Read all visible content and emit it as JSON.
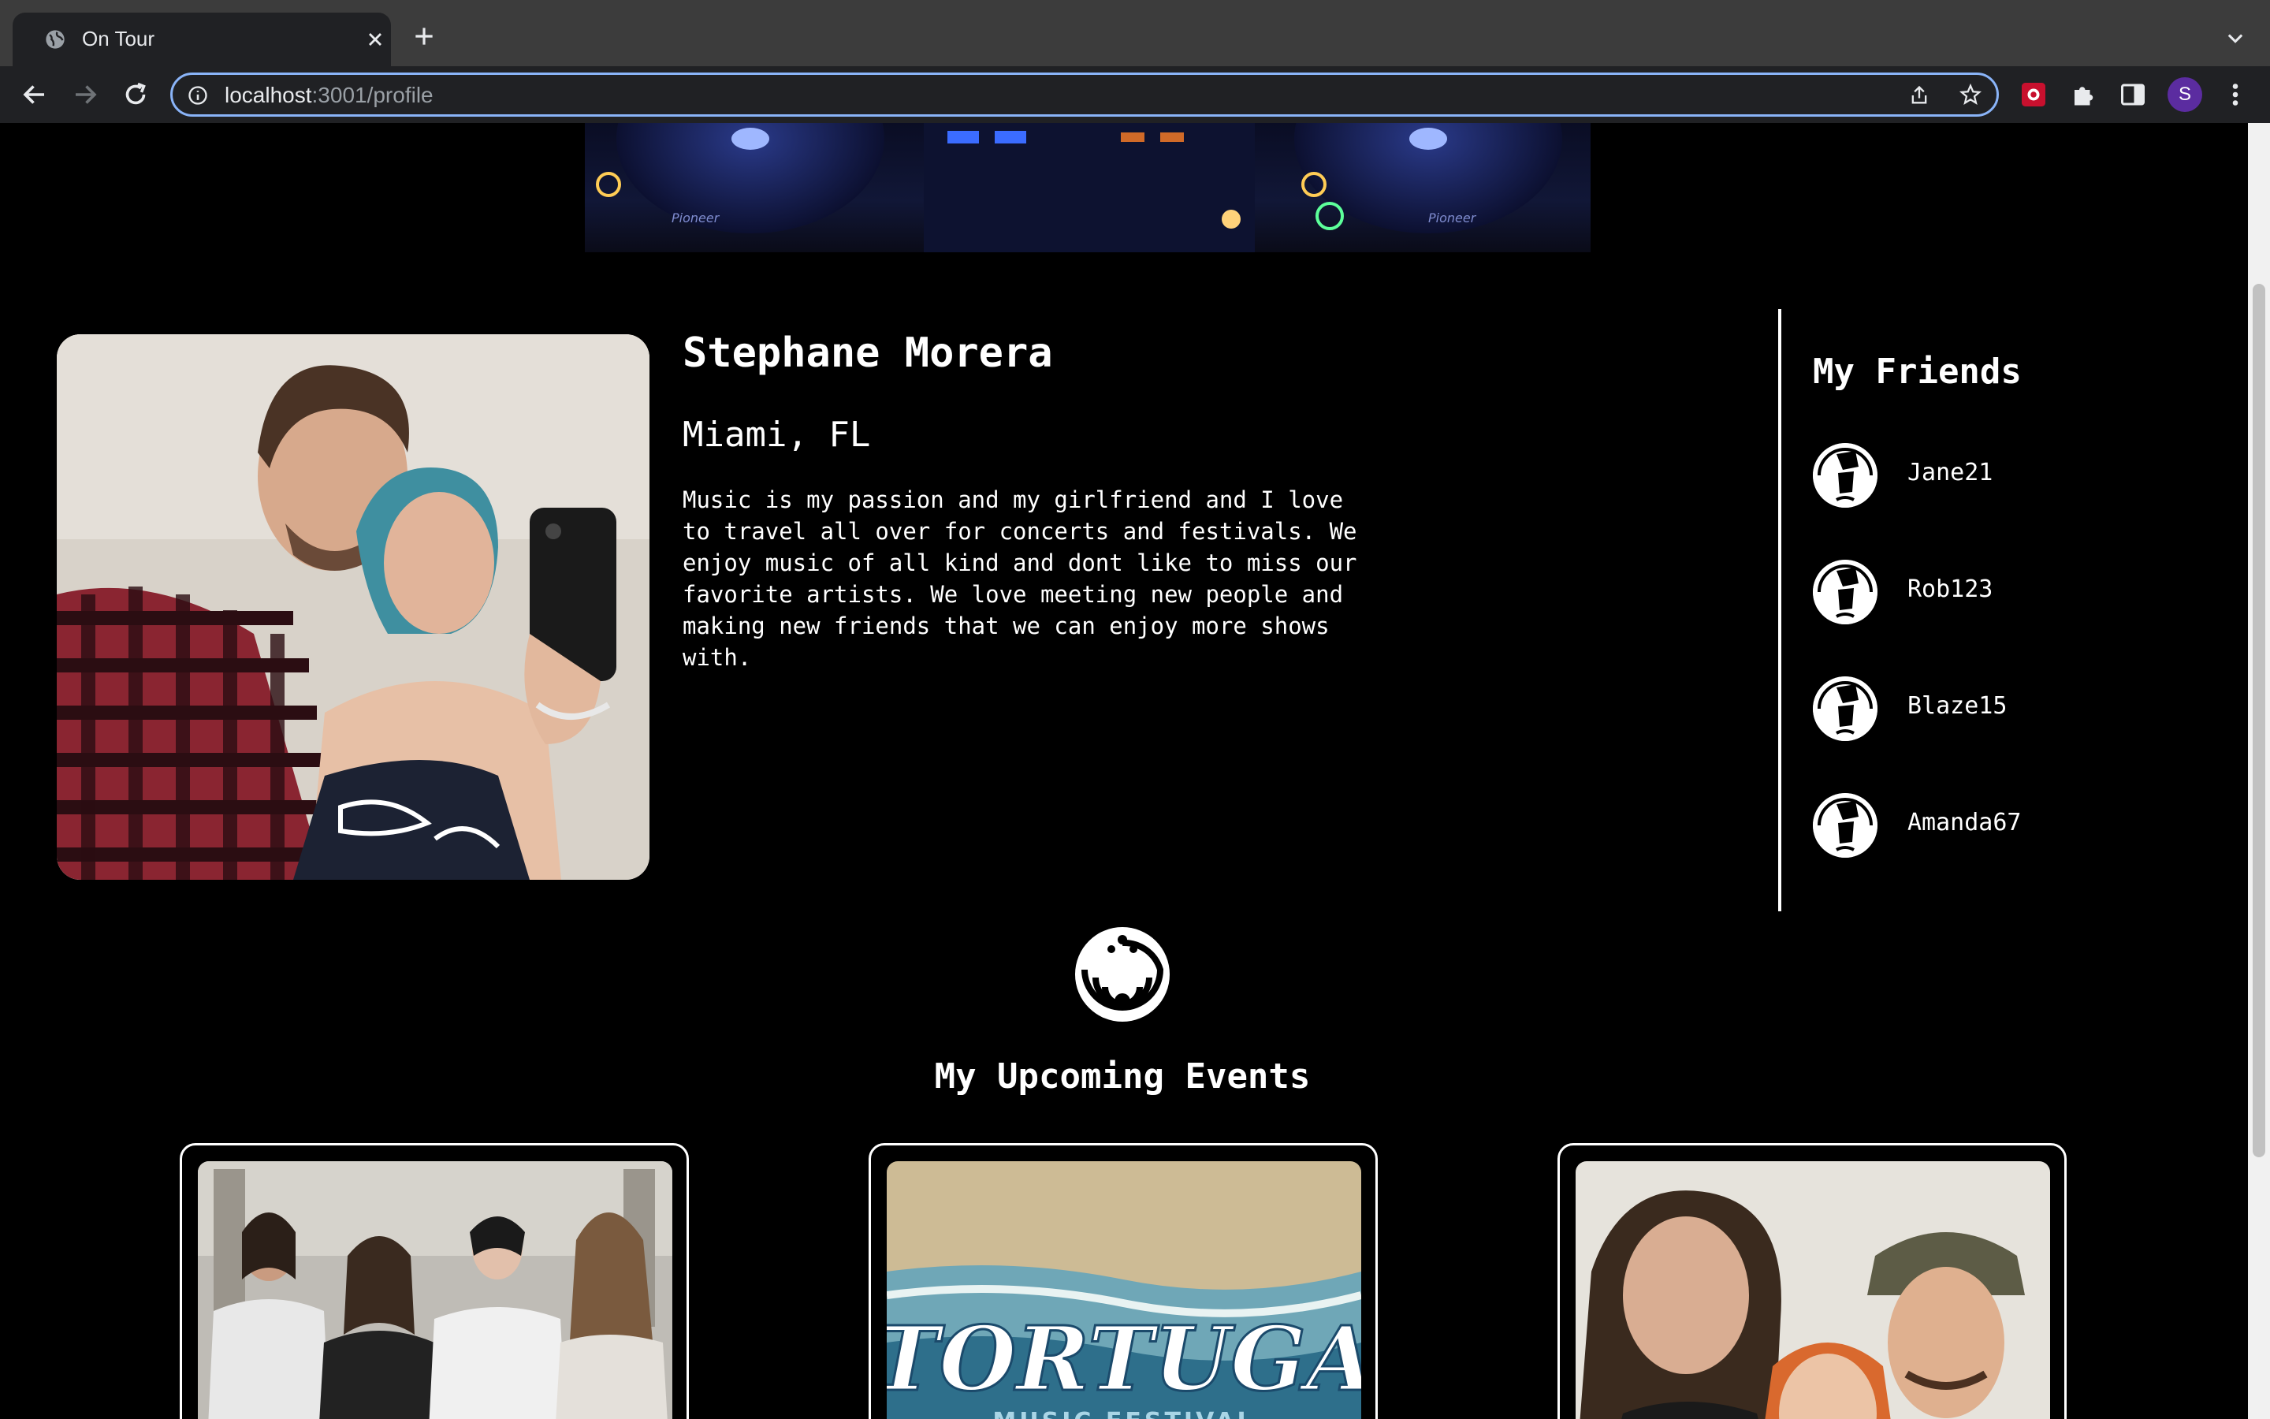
{
  "browser": {
    "tab_title": "On Tour",
    "url_host": "localhost",
    "url_path": ":3001/profile",
    "profile_initial": "S"
  },
  "profile": {
    "name": "Stephane Morera",
    "location": "Miami, FL",
    "bio": "Music is my passion and my girlfriend and I love to travel all over for concerts and festivals. We enjoy music of all kind and dont like to miss our favorite artists. We love meeting new people and making new friends that we can enjoy more shows with."
  },
  "friends": {
    "title": "My Friends",
    "items": [
      {
        "name": "Jane21"
      },
      {
        "name": "Rob123"
      },
      {
        "name": "Blaze15"
      },
      {
        "name": "Amanda67"
      }
    ]
  },
  "events": {
    "title": "My Upcoming Events",
    "cards": [
      {
        "image": "band-photo"
      },
      {
        "image": "tortuga-festival-poster",
        "poster_title": "TORTUGA",
        "poster_subtitle": "MUSIC FESTIVAL"
      },
      {
        "image": "band-photo"
      }
    ]
  },
  "colors": {
    "page_bg": "#000000",
    "text": "#ffffff",
    "omnibox_focus": "#8ab4f8",
    "avatar": "#5b2ca0"
  }
}
